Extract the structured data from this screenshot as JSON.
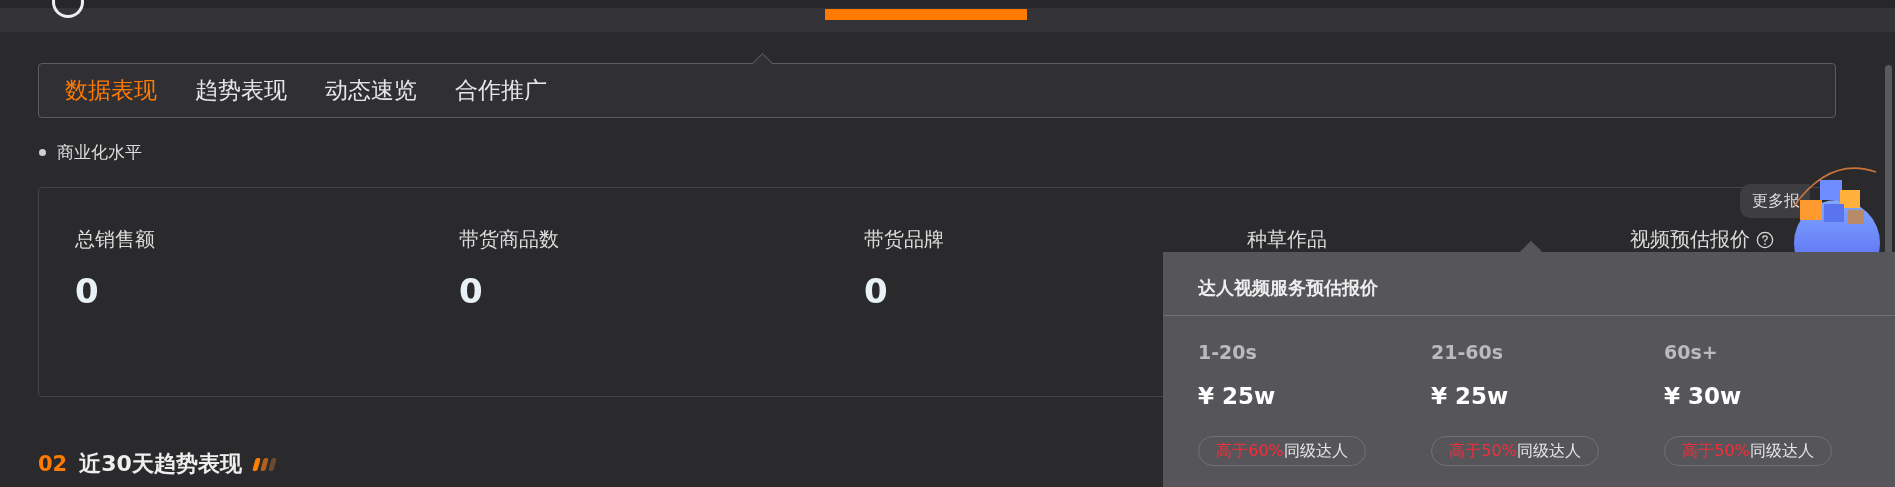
{
  "tabs": [
    {
      "label": "数据表现",
      "selected": true
    },
    {
      "label": "趋势表现",
      "selected": false
    },
    {
      "label": "动态速览",
      "selected": false
    },
    {
      "label": "合作推广",
      "selected": false
    }
  ],
  "subsection": "商业化水平",
  "metrics": [
    {
      "label": "总销售额",
      "value": "0"
    },
    {
      "label": "带货商品数",
      "value": "0"
    },
    {
      "label": "带货品牌",
      "value": "0"
    },
    {
      "label": "种草作品"
    },
    {
      "label": "视频预估报价",
      "help": true
    }
  ],
  "more_quotes": "更多报",
  "quote_popup": {
    "title": "达人视频服务预估报价",
    "columns": [
      {
        "duration": "1-20s",
        "price": "¥ 25w",
        "highlight": "高于60%",
        "comparison": "同级达人"
      },
      {
        "duration": "21-60s",
        "price": "¥ 25w",
        "highlight": "高于50%",
        "comparison": "同级达人"
      },
      {
        "duration": "60s+",
        "price": "¥ 30w",
        "highlight": "高于50%",
        "comparison": "同级达人"
      }
    ]
  },
  "section": {
    "number": "02",
    "title": "近30天趋势表现"
  }
}
